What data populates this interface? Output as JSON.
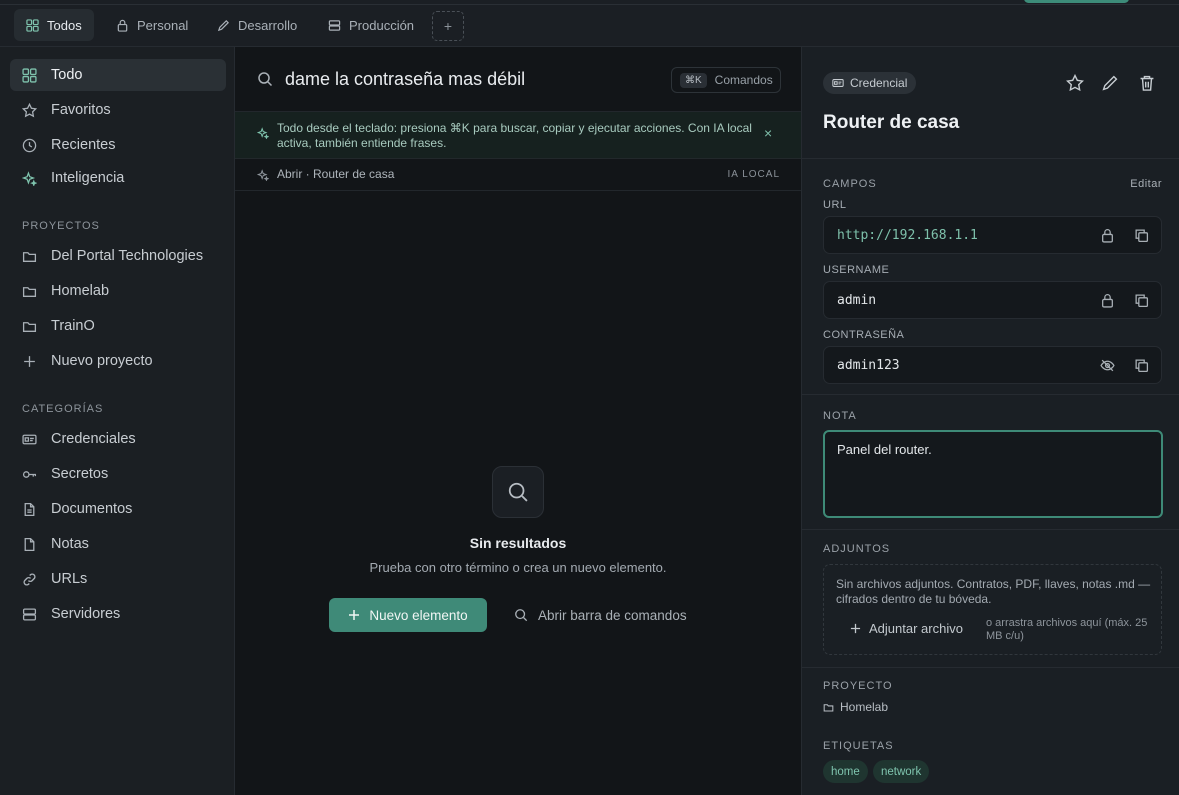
{
  "tabs": [
    {
      "label": "Todos",
      "icon": "grid-icon",
      "active": true
    },
    {
      "label": "Personal",
      "icon": "lock-icon",
      "active": false
    },
    {
      "label": "Desarrollo",
      "icon": "pencil-icon",
      "active": false
    },
    {
      "label": "Producción",
      "icon": "server-icon",
      "active": false
    }
  ],
  "tab_add": "+",
  "sidebar": {
    "main_items": [
      {
        "label": "Todo",
        "icon": "grid-icon",
        "active": true
      },
      {
        "label": "Favoritos",
        "icon": "star-icon"
      },
      {
        "label": "Recientes",
        "icon": "clock-icon"
      },
      {
        "label": "Inteligencia",
        "icon": "sparkle-icon"
      }
    ],
    "projects_heading": "PROYECTOS",
    "projects": [
      {
        "label": "Del Portal Technologies",
        "icon": "folder-icon"
      },
      {
        "label": "Homelab",
        "icon": "folder-icon"
      },
      {
        "label": "TrainO",
        "icon": "folder-icon"
      },
      {
        "label": "Nuevo proyecto",
        "icon": "plus-icon"
      }
    ],
    "categories_heading": "CATEGORÍAS",
    "categories": [
      {
        "label": "Credenciales",
        "icon": "id-card-icon"
      },
      {
        "label": "Secretos",
        "icon": "key-icon"
      },
      {
        "label": "Documentos",
        "icon": "document-icon"
      },
      {
        "label": "Notas",
        "icon": "note-icon"
      },
      {
        "label": "URLs",
        "icon": "link-icon"
      },
      {
        "label": "Servidores",
        "icon": "server-icon"
      }
    ]
  },
  "search": {
    "query": "dame la contraseña mas débil",
    "shortcut": "⌘K",
    "commands_label": "Comandos"
  },
  "banner": {
    "text": "Todo desde el teclado: presiona ⌘K para buscar, copiar y ejecutar acciones. Con IA local activa, también entiende frases.",
    "close": "×"
  },
  "suggestion": {
    "text": "Abrir · Router de casa",
    "badge": "IA LOCAL"
  },
  "empty": {
    "title": "Sin resultados",
    "subtitle": "Prueba con otro término o crea un nuevo elemento.",
    "new_button": "Nuevo elemento",
    "command_button": "Abrir barra de comandos"
  },
  "detail": {
    "type_badge": "Credencial",
    "title": "Router de casa",
    "fields_heading": "CAMPOS",
    "edit_label": "Editar",
    "fields": [
      {
        "label": "URL",
        "value": "http://192.168.1.1",
        "icon": "lock-icon"
      },
      {
        "label": "USERNAME",
        "value": "admin",
        "icon": "lock-icon"
      },
      {
        "label": "CONTRASEÑA",
        "value": "admin123",
        "icon": "eye-off-icon"
      }
    ],
    "note_heading": "NOTA",
    "note": "Panel del router.",
    "attachments_heading": "ADJUNTOS",
    "attachments_text": "Sin archivos adjuntos. Contratos, PDF, llaves, notas .md — cifrados dentro de tu bóveda.",
    "attach_button": "Adjuntar archivo",
    "attach_hint": "o arrastra archivos aquí (máx. 25 MB c/u)",
    "project_heading": "PROYECTO",
    "project": "Homelab",
    "tags_heading": "ETIQUETAS",
    "tags": [
      "home",
      "network"
    ]
  },
  "colors": {
    "accent": "#3f8a78",
    "accent_text": "#7fc4ae",
    "background": "#121518",
    "panel": "#1a1f24"
  }
}
